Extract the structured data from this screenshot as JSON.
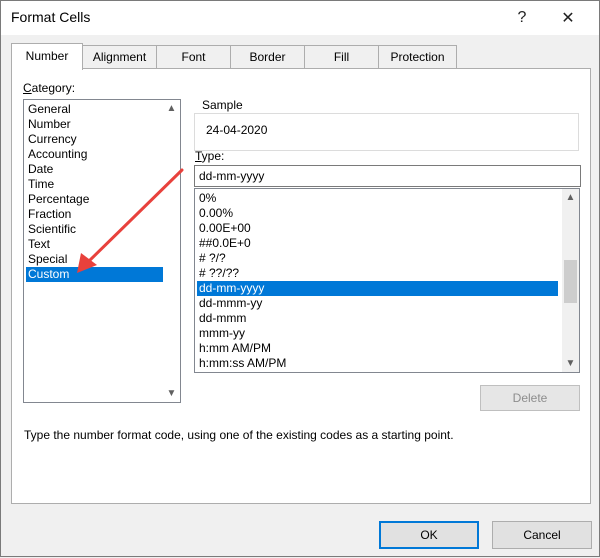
{
  "window": {
    "title": "Format Cells",
    "help_label": "?",
    "close_label": "✕"
  },
  "tabs": [
    {
      "label": "Number",
      "active": true
    },
    {
      "label": "Alignment",
      "active": false
    },
    {
      "label": "Font",
      "active": false
    },
    {
      "label": "Border",
      "active": false
    },
    {
      "label": "Fill",
      "active": false
    },
    {
      "label": "Protection",
      "active": false
    }
  ],
  "category": {
    "label": "Category:",
    "items": [
      "General",
      "Number",
      "Currency",
      "Accounting",
      "Date",
      "Time",
      "Percentage",
      "Fraction",
      "Scientific",
      "Text",
      "Special",
      "Custom"
    ],
    "selected": "Custom"
  },
  "sample": {
    "label": "Sample",
    "value": "24-04-2020"
  },
  "type": {
    "label": "Type:",
    "value": "dd-mm-yyyy",
    "items": [
      "0%",
      "0.00%",
      "0.00E+00",
      "##0.0E+0",
      "# ?/?",
      "# ??/??",
      "dd-mm-yyyy",
      "dd-mmm-yy",
      "dd-mmm",
      "mmm-yy",
      "h:mm AM/PM",
      "h:mm:ss AM/PM"
    ],
    "selected": "dd-mm-yyyy"
  },
  "buttons": {
    "delete": "Delete",
    "ok": "OK",
    "cancel": "Cancel"
  },
  "hint": "Type the number format code, using one of the existing codes as a starting point.",
  "icons": {
    "scroll_up": "chevron-up-icon",
    "scroll_down": "chevron-down-icon",
    "annotation": "red-arrow-icon"
  },
  "colors": {
    "selection": "#0078d7",
    "annotation_arrow": "#e8413c",
    "dialog_bg": "#f0f0f0"
  }
}
